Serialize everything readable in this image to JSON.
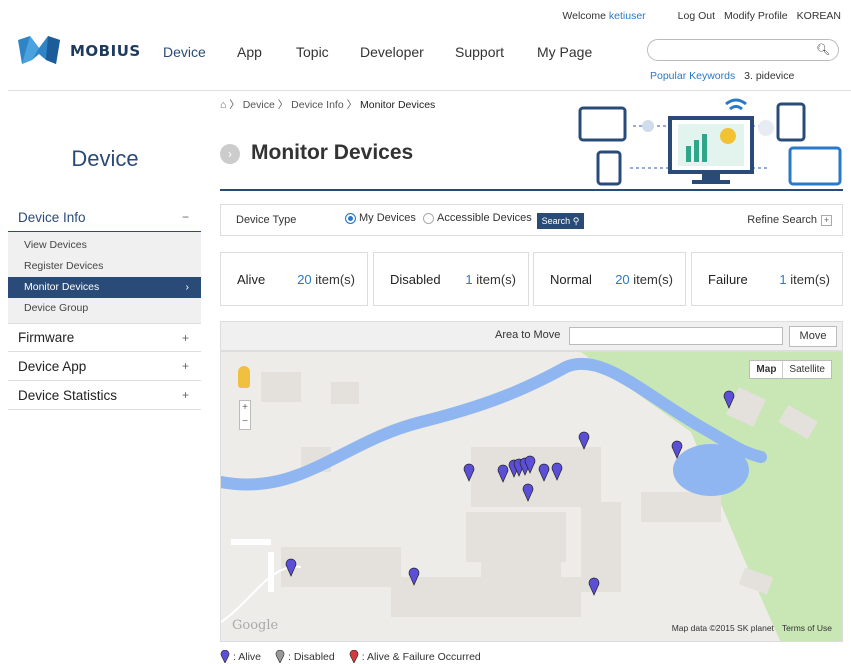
{
  "util": {
    "welcome": "Welcome",
    "username": "ketiuser",
    "logout": "Log Out",
    "modify": "Modify Profile",
    "lang": "KOREAN"
  },
  "brand": {
    "name": "MOBIUS"
  },
  "nav": [
    "Device",
    "App",
    "Topic",
    "Developer",
    "Support",
    "My Page"
  ],
  "search": {
    "placeholder": "",
    "popular_label": "Popular Keywords",
    "popular_item": "3. pidevice"
  },
  "breadcrumb": {
    "sep": "〉",
    "items": [
      "Device",
      "Device Info",
      "Monitor Devices"
    ]
  },
  "page_title": "Monitor Devices",
  "sidebar": {
    "title": "Device",
    "sections": [
      {
        "label": "Device Info",
        "toggle": "−",
        "items": [
          "View Devices",
          "Register Devices",
          "Monitor Devices",
          "Device Group"
        ]
      },
      {
        "label": "Firmware",
        "toggle": "+"
      },
      {
        "label": "Device App",
        "toggle": "+"
      },
      {
        "label": "Device Statistics",
        "toggle": "+"
      }
    ]
  },
  "filter": {
    "label": "Device Type",
    "opt_my": "My Devices",
    "opt_access": "Accessible Devices",
    "search_btn": "Search",
    "refine": "Refine Search"
  },
  "stats": [
    {
      "label": "Alive",
      "count": "20",
      "unit": " item(s)"
    },
    {
      "label": "Disabled",
      "count": "1",
      "unit": " item(s)"
    },
    {
      "label": "Normal",
      "count": "20",
      "unit": " item(s)"
    },
    {
      "label": "Failure",
      "count": "1",
      "unit": " item(s)"
    }
  ],
  "move": {
    "label": "Area to Move",
    "value": "",
    "button": "Move"
  },
  "map": {
    "type_map": "Map",
    "type_sat": "Satellite",
    "attribution": "Map data ©2015 SK planet",
    "terms": "Terms of Use",
    "logo": "Google",
    "zoom_in": "+",
    "zoom_out": "−"
  },
  "legend": [
    {
      "label": ": Alive",
      "color": "#5a4fd6"
    },
    {
      "label": ": Disabled",
      "color": "#999999"
    },
    {
      "label": ": Alive & Failure Occurred",
      "color": "#d63b3b"
    }
  ],
  "colors": {
    "accent": "#2a4b78",
    "link": "#2a78c8",
    "river": "#8fb6f0",
    "park": "#c9e6b5"
  }
}
